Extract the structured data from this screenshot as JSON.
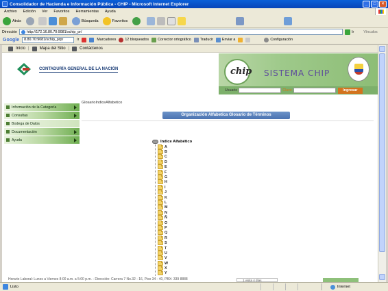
{
  "window": {
    "title": "Consolidador de Hacienda e Información Pública - CHIP - Microsoft Internet Explorer",
    "min_label": "_",
    "max_label": "□",
    "close_label": "×"
  },
  "menubar": [
    "Archivo",
    "Edición",
    "Ver",
    "Favoritos",
    "Herramientas",
    "Ayuda"
  ],
  "toolbar": {
    "back_label": "Atrás",
    "search_label": "Búsqueda",
    "favorites_label": "Favoritos"
  },
  "address": {
    "label": "Dirección",
    "url": "http://172.16.80.70:9081/schip_pr/",
    "go_label": "Ir",
    "links_label": "Vínculos"
  },
  "googlebar": {
    "logo": "Google",
    "field_value": "8.80.70:9081/schip_prpr",
    "go_label": "Ir",
    "bookmarks_label": "Marcadores",
    "blocked_label": "12 bloqueados",
    "spell_label": "Corrector ortográfico",
    "translate_label": "Traducir",
    "send_label": "Enviar a",
    "settings_label": "Configuración"
  },
  "sitenav": [
    "Inicio",
    "Mapa del Sitio",
    "Contáctenos"
  ],
  "header": {
    "org_name": "CONTADURÍA GENERAL DE LA NACIÓN",
    "chip_logo": "chip",
    "system_title": "SISTEMA CHIP",
    "user_label": "Usuario",
    "password_label": "Clave",
    "login_button": "Ingresar"
  },
  "leftmenu": [
    {
      "label": "Información de la Categoría",
      "has_arrow": true
    },
    {
      "label": "Consultas",
      "has_arrow": true
    },
    {
      "label": "Bodega de Datos",
      "has_arrow": false
    },
    {
      "label": "Documentación",
      "has_arrow": true
    },
    {
      "label": "Ayuda",
      "has_arrow": true
    }
  ],
  "breadcrumb": "GlosarioIndiceAlfabetico",
  "gloss_title": "Organización Alfabetica Glosario de Términos",
  "tree": {
    "root_label": "Indice Alfabético",
    "nodes": [
      "A",
      "B",
      "C",
      "D",
      "E",
      "F",
      "G",
      "H",
      "I",
      "J",
      "K",
      "L",
      "M",
      "N",
      "Ñ",
      "O",
      "P",
      "Q",
      "R",
      "S",
      "T",
      "U",
      "V",
      "W",
      "X",
      "Y"
    ]
  },
  "footer": {
    "text": "Horario Laboral: Lunes a Viernes 8:00 a.m. a 5:00 p.m. - Dirección: Carrera 7 No.32 - 16, Piso 34 - 40, PBX: 339 8888",
    "box_text": "1 visita 4 días"
  },
  "statusbar": {
    "status": "Listo",
    "zone": "Internet"
  },
  "colors": {
    "menu_green": "#6fae51",
    "title_blue": "#4a72b0",
    "login_orange": "#d3731e",
    "sistema_purple": "#5d4b9b"
  }
}
